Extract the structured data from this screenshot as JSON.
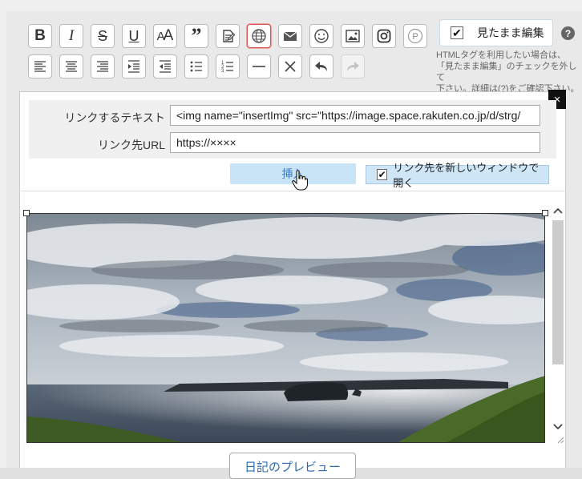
{
  "toolbar": {
    "row1": [
      {
        "icon": "bold-icon",
        "glyph": "B"
      },
      {
        "icon": "italic-icon",
        "glyph": "I"
      },
      {
        "icon": "strikethrough-icon",
        "glyph": "S"
      },
      {
        "icon": "underline-icon",
        "glyph": "U"
      },
      {
        "icon": "font-size-icon",
        "glyph": "AA"
      },
      {
        "icon": "quote-icon",
        "glyph": "❞"
      },
      {
        "icon": "note-icon",
        "glyph": ""
      },
      {
        "icon": "link-globe-icon",
        "glyph": ""
      },
      {
        "icon": "mail-icon",
        "glyph": "✉"
      },
      {
        "icon": "emoji-icon",
        "glyph": "☺"
      },
      {
        "icon": "image-icon",
        "glyph": ""
      },
      {
        "icon": "instagram-icon",
        "glyph": ""
      },
      {
        "icon": "p-circle-icon",
        "glyph": "P"
      }
    ],
    "row2": [
      {
        "icon": "align-left-icon"
      },
      {
        "icon": "align-center-icon"
      },
      {
        "icon": "align-right-icon"
      },
      {
        "icon": "indent-icon"
      },
      {
        "icon": "outdent-icon"
      },
      {
        "icon": "bullet-list-icon"
      },
      {
        "icon": "numbered-list-icon"
      },
      {
        "icon": "horizontal-rule-icon"
      },
      {
        "icon": "clear-format-icon"
      },
      {
        "icon": "undo-icon"
      },
      {
        "icon": "redo-icon"
      }
    ],
    "wysiwyg_label": "見たまま編集",
    "wysiwyg_checked": true,
    "help_label": "?",
    "note_line1": "HTMLタグを利用したい場合は、",
    "note_line2": "「見たまま編集」のチェックを外して",
    "note_line3": "下さい。詳細は(?)をご確認下さい。"
  },
  "link_dialog": {
    "close_label": "×",
    "text_label": "リンクするテキスト",
    "text_value": "<img name=\"insertImg\" src=\"https://image.space.rakuten.co.jp/d/strg/",
    "url_label": "リンク先URL",
    "url_value": "https://××××",
    "insert_label": "挿入",
    "new_window_label": "リンク先を新しいウィンドウで開く",
    "new_window_checked": true
  },
  "preview_button": "日記のプレビュー"
}
